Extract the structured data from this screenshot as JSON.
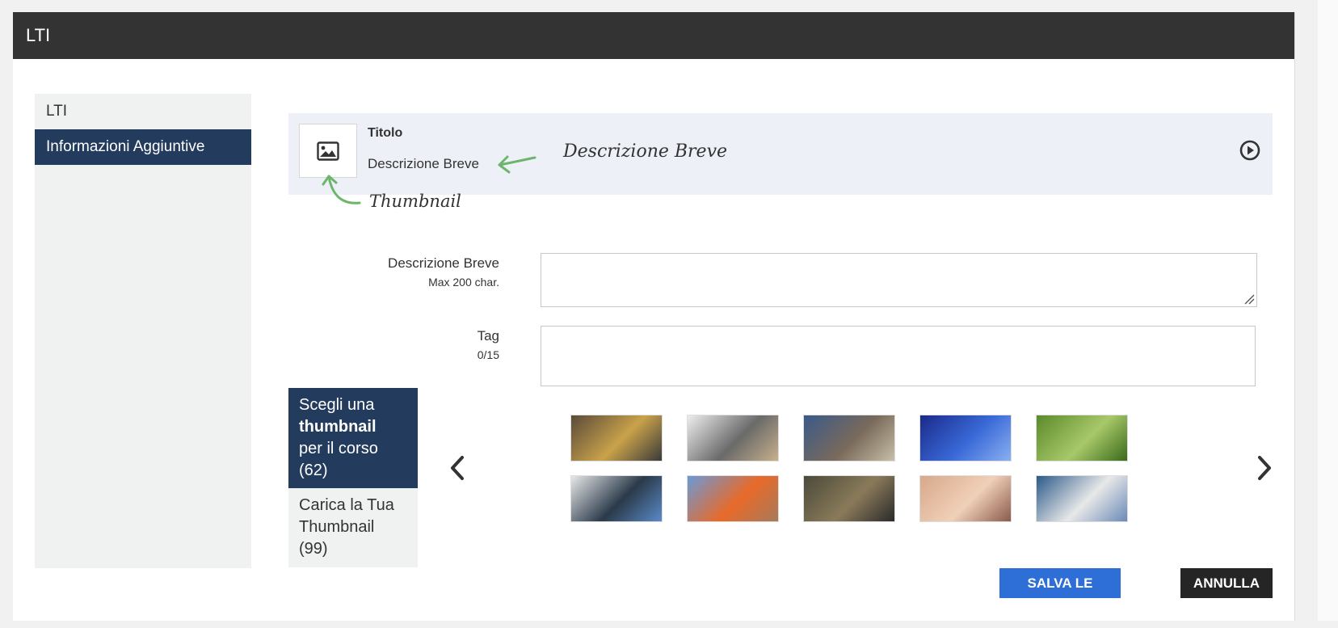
{
  "window": {
    "title": "LTI"
  },
  "sidebar": {
    "items": [
      {
        "label": "LTI"
      },
      {
        "label": "Informazioni Aggiuntive"
      }
    ]
  },
  "preview": {
    "title": "Titolo",
    "description": "Descrizione Breve",
    "thumbnail_icon": "image-icon",
    "play_icon": "play-circle-icon"
  },
  "annotations": {
    "description": "Descrizione Breve",
    "thumbnail": "Thumbnail",
    "color": "#6db56d"
  },
  "form": {
    "description": {
      "label": "Descrizione Breve",
      "hint": "Max 200 char.",
      "value": ""
    },
    "tag": {
      "label": "Tag",
      "hint": "0/15",
      "value": ""
    }
  },
  "thumbnail_tabs": {
    "choose": {
      "line1": "Scegli una",
      "bold": "thumbnail",
      "line3": "per il corso",
      "count": "(62)"
    },
    "upload": {
      "line1": "Carica la Tua",
      "line2": "Thumbnail",
      "count": "(99)"
    }
  },
  "gallery": {
    "prev_icon": "chevron-left-icon",
    "next_icon": "chevron-right-icon",
    "thumbnails": [
      {
        "name": "workers-thumbnail",
        "colors": [
          "#5a4a3a",
          "#c9a24a",
          "#3a3a3a"
        ]
      },
      {
        "name": "laptop-thumbnail",
        "colors": [
          "#eeeeee",
          "#6a6a6a",
          "#c8b08a"
        ]
      },
      {
        "name": "coffee-thumbnail",
        "colors": [
          "#3a5a8a",
          "#7a6a5a",
          "#c8c0a8"
        ]
      },
      {
        "name": "chart-thumbnail",
        "colors": [
          "#1a2a8a",
          "#3a6ad8",
          "#8ab0f0"
        ]
      },
      {
        "name": "grass-thumbnail",
        "colors": [
          "#5a8a2a",
          "#a8c86a",
          "#3a6a1a"
        ]
      },
      {
        "name": "doctors-thumbnail",
        "colors": [
          "#e8e8e8",
          "#2a3a4a",
          "#5a8ac8"
        ]
      },
      {
        "name": "engineer-thumbnail",
        "colors": [
          "#6a9ad8",
          "#e86a2a",
          "#a87a5a"
        ]
      },
      {
        "name": "warehouse-thumbnail",
        "colors": [
          "#4a4a3a",
          "#8a7a5a",
          "#2a2a2a"
        ]
      },
      {
        "name": "face-thumbnail",
        "colors": [
          "#d8a88a",
          "#f0d0b8",
          "#8a5a4a"
        ]
      },
      {
        "name": "classroom-thumbnail",
        "colors": [
          "#2a5a8a",
          "#e8e8e8",
          "#6a8ab8"
        ]
      }
    ]
  },
  "actions": {
    "save": "SALVA LE MODIFICHE",
    "cancel": "ANNULLA"
  }
}
